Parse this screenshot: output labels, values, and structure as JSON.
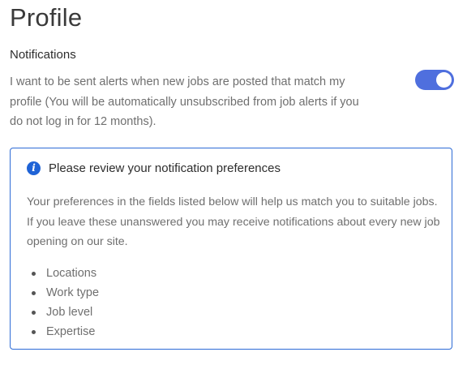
{
  "page": {
    "title": "Profile"
  },
  "notifications": {
    "heading": "Notifications",
    "description": "I want to be sent alerts when new jobs are posted that match my profile (You will be automatically unsubscribed from job alerts if you do not log in for 12 months).",
    "toggle_on": true,
    "toggle_color": "#4f6fde"
  },
  "info_box": {
    "icon": "info-icon",
    "icon_glyph": "i",
    "title": "Please review your notification preferences",
    "body": "Your preferences in the fields listed below will help us match you to suitable jobs. If you leave these unanswered you may receive notifications about every new job opening on our site.",
    "items": [
      {
        "label": "Locations"
      },
      {
        "label": "Work type"
      },
      {
        "label": "Job level"
      },
      {
        "label": "Expertise"
      }
    ],
    "border_color": "#2d6bd6"
  }
}
